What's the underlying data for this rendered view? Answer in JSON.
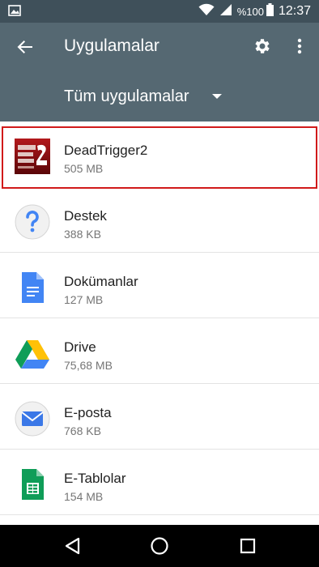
{
  "status_bar": {
    "battery": "%100",
    "time": "12:37"
  },
  "app_bar": {
    "title": "Uygulamalar"
  },
  "filter": {
    "label": "Tüm uygulamalar"
  },
  "apps": [
    {
      "name": "DeadTrigger2",
      "size": "505 MB",
      "icon": "dead-trigger-2-icon",
      "highlighted": true
    },
    {
      "name": "Destek",
      "size": "388 KB",
      "icon": "help-question-icon"
    },
    {
      "name": "Dokümanlar",
      "size": "127 MB",
      "icon": "google-docs-icon"
    },
    {
      "name": "Drive",
      "size": "75,68 MB",
      "icon": "google-drive-icon"
    },
    {
      "name": "E-posta",
      "size": "768 KB",
      "icon": "email-envelope-icon"
    },
    {
      "name": "E-Tablolar",
      "size": "154 MB",
      "icon": "google-sheets-icon"
    }
  ],
  "colors": {
    "status_bar": "#3f505a",
    "app_bar": "#556872",
    "highlight_border": "#d11a1a"
  }
}
